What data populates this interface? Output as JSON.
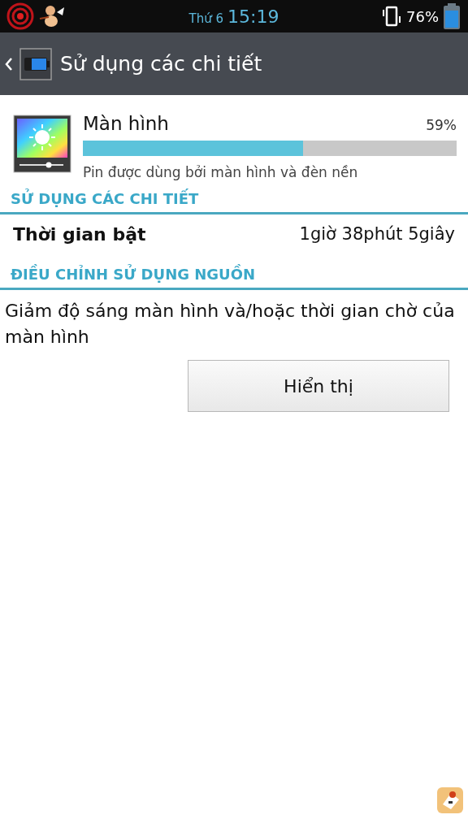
{
  "status_bar": {
    "day": "Thứ 6",
    "time": "15:19",
    "battery": "76%"
  },
  "action_bar": {
    "title": "Sử dụng các chi tiết"
  },
  "app": {
    "name": "Màn hình",
    "percent": "59%",
    "level": 0.59,
    "description": "Pin được dùng bởi màn hình và đèn nền"
  },
  "sections": [
    {
      "header": "SỬ DỤNG CÁC CHI TIẾT",
      "kind": "row",
      "label": "Thời gian bật",
      "value": "1giờ 38phút 5giây"
    },
    {
      "header": "ĐIỀU CHỈNH SỬ DỤNG NGUỒN",
      "kind": "action",
      "text": "Giảm độ sáng màn hình và/hoặc thời gian chờ của màn hình",
      "button": "Hiển thị"
    }
  ]
}
